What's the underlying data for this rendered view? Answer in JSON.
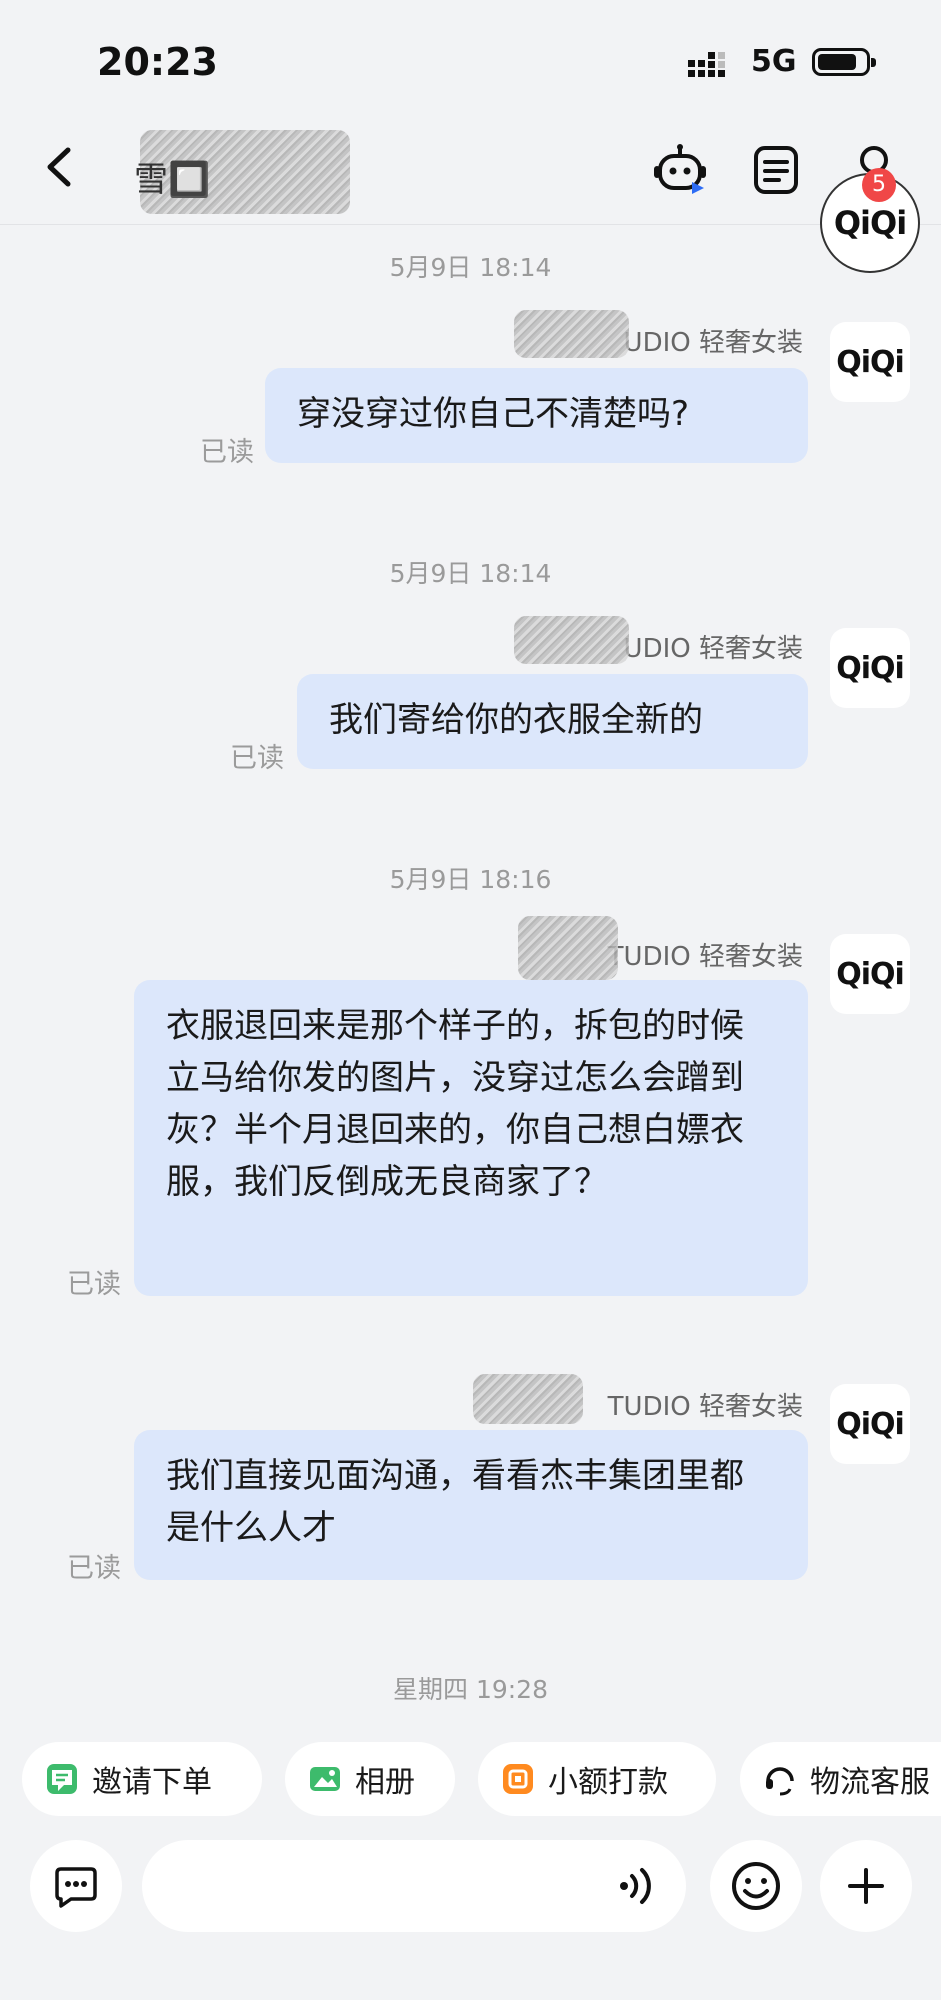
{
  "status_bar": {
    "time": "20:23",
    "network": "5G"
  },
  "header": {
    "title": "雪🔲",
    "avatar_text": "QiQi",
    "badge_count": "5"
  },
  "messages": [
    {
      "timestamp": "5月9日 18:14",
      "sender": "UDIO 轻奢女装",
      "avatar": "QiQi",
      "text": "穿没穿过你自己不清楚吗?",
      "read": "已读"
    },
    {
      "timestamp": "5月9日 18:14",
      "sender": "UDIO 轻奢女装",
      "avatar": "QiQi",
      "text": "我们寄给你的衣服全新的",
      "read": "已读"
    },
    {
      "timestamp": "5月9日 18:16",
      "sender": "TUDIO 轻奢女装",
      "avatar": "QiQi",
      "text": "衣服退回来是那个样子的，拆包的时候立马给你发的图片，没穿过怎么会蹭到灰？半个月退回来的，你自己想白嫖衣服，我们反倒成无良商家了？",
      "read": "已读"
    },
    {
      "timestamp": "",
      "sender": "TUDIO 轻奢女装",
      "avatar": "QiQi",
      "text": "我们直接见面沟通，看看杰丰集团里都是什么人才",
      "read": "已读"
    }
  ],
  "last_timestamp": "星期四 19:28",
  "quick_actions": [
    "邀请下单",
    "相册",
    "小额打款",
    "物流客服"
  ],
  "input": {
    "placeholder": ""
  },
  "colors": {
    "background": "#f2f3f5",
    "bubble": "#dce7fb",
    "badge": "#f04747",
    "chip_green": "#3dbb6c",
    "chip_orange": "#ff8a1f"
  }
}
